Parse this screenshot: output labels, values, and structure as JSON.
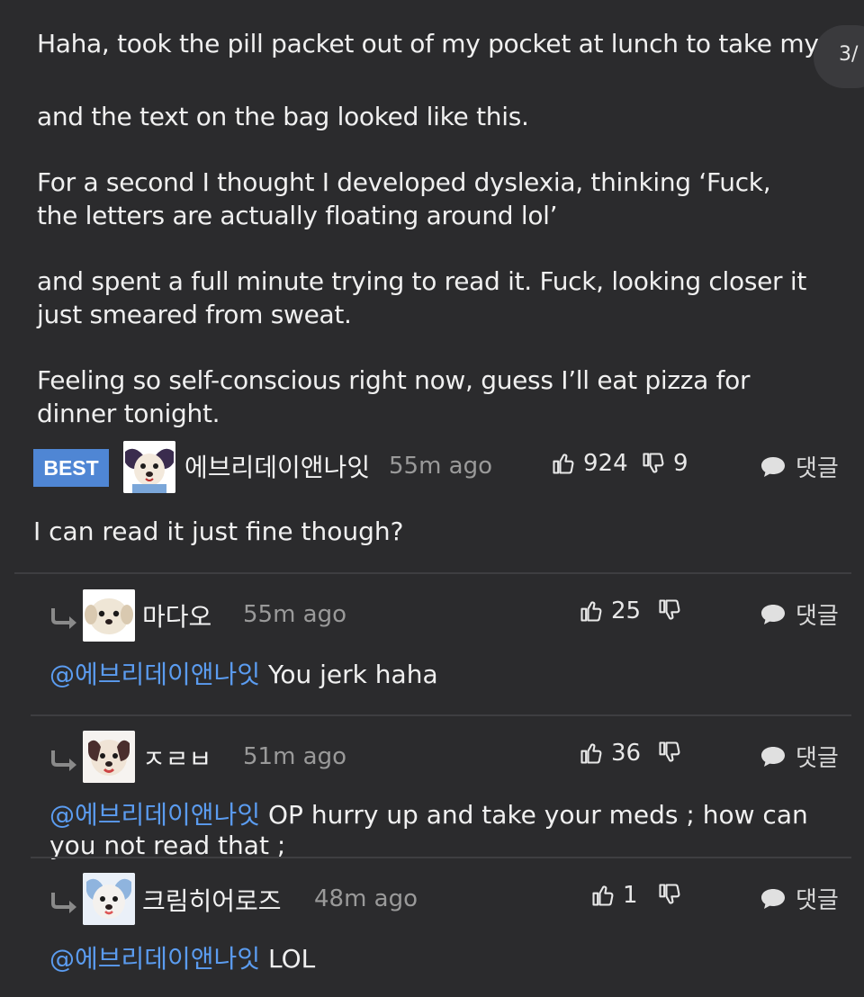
{
  "post": {
    "paragraphs": [
      "Haha, took the pill packet out of my pocket at lunch to take my meds",
      "and the text on the bag looked like this.",
      "For a second I thought I developed dyslexia, thinking ‘Fuck, the letters are actually floating around lol’",
      "and spent a full minute trying to read it. Fuck, looking closer it just smeared from sweat.",
      "Feeling so self-conscious right now, guess I’ll eat pizza for dinner tonight."
    ],
    "page_indicator": "3/"
  },
  "comments": [
    {
      "badge": "BEST",
      "username": "에브리데이앤나잇",
      "time": "55m ago",
      "upvotes": "924",
      "downvotes": "9",
      "reply_label": "댓글",
      "text": "I can read it just fine though?"
    },
    {
      "username": "마다오",
      "time": "55m ago",
      "upvotes": "25",
      "downvotes": "",
      "reply_label": "댓글",
      "mention": "@에브리데이앤나잇",
      "text": " You jerk haha"
    },
    {
      "username": "ㅈㄹㅂ",
      "time": "51m ago",
      "upvotes": "36",
      "downvotes": "",
      "reply_label": "댓글",
      "mention": "@에브리데이앤나잇",
      "text": " OP hurry up and take your meds ; how can you not read that ;"
    },
    {
      "username": "크림히어로즈",
      "time": "48m ago",
      "upvotes": "1",
      "downvotes": "",
      "reply_label": "댓글",
      "mention": "@에브리데이앤나잇",
      "text": " LOL"
    }
  ],
  "colors": {
    "background": "#2b2b2d",
    "mention": "#5b9cf0",
    "best_badge": "#4f86d4"
  }
}
